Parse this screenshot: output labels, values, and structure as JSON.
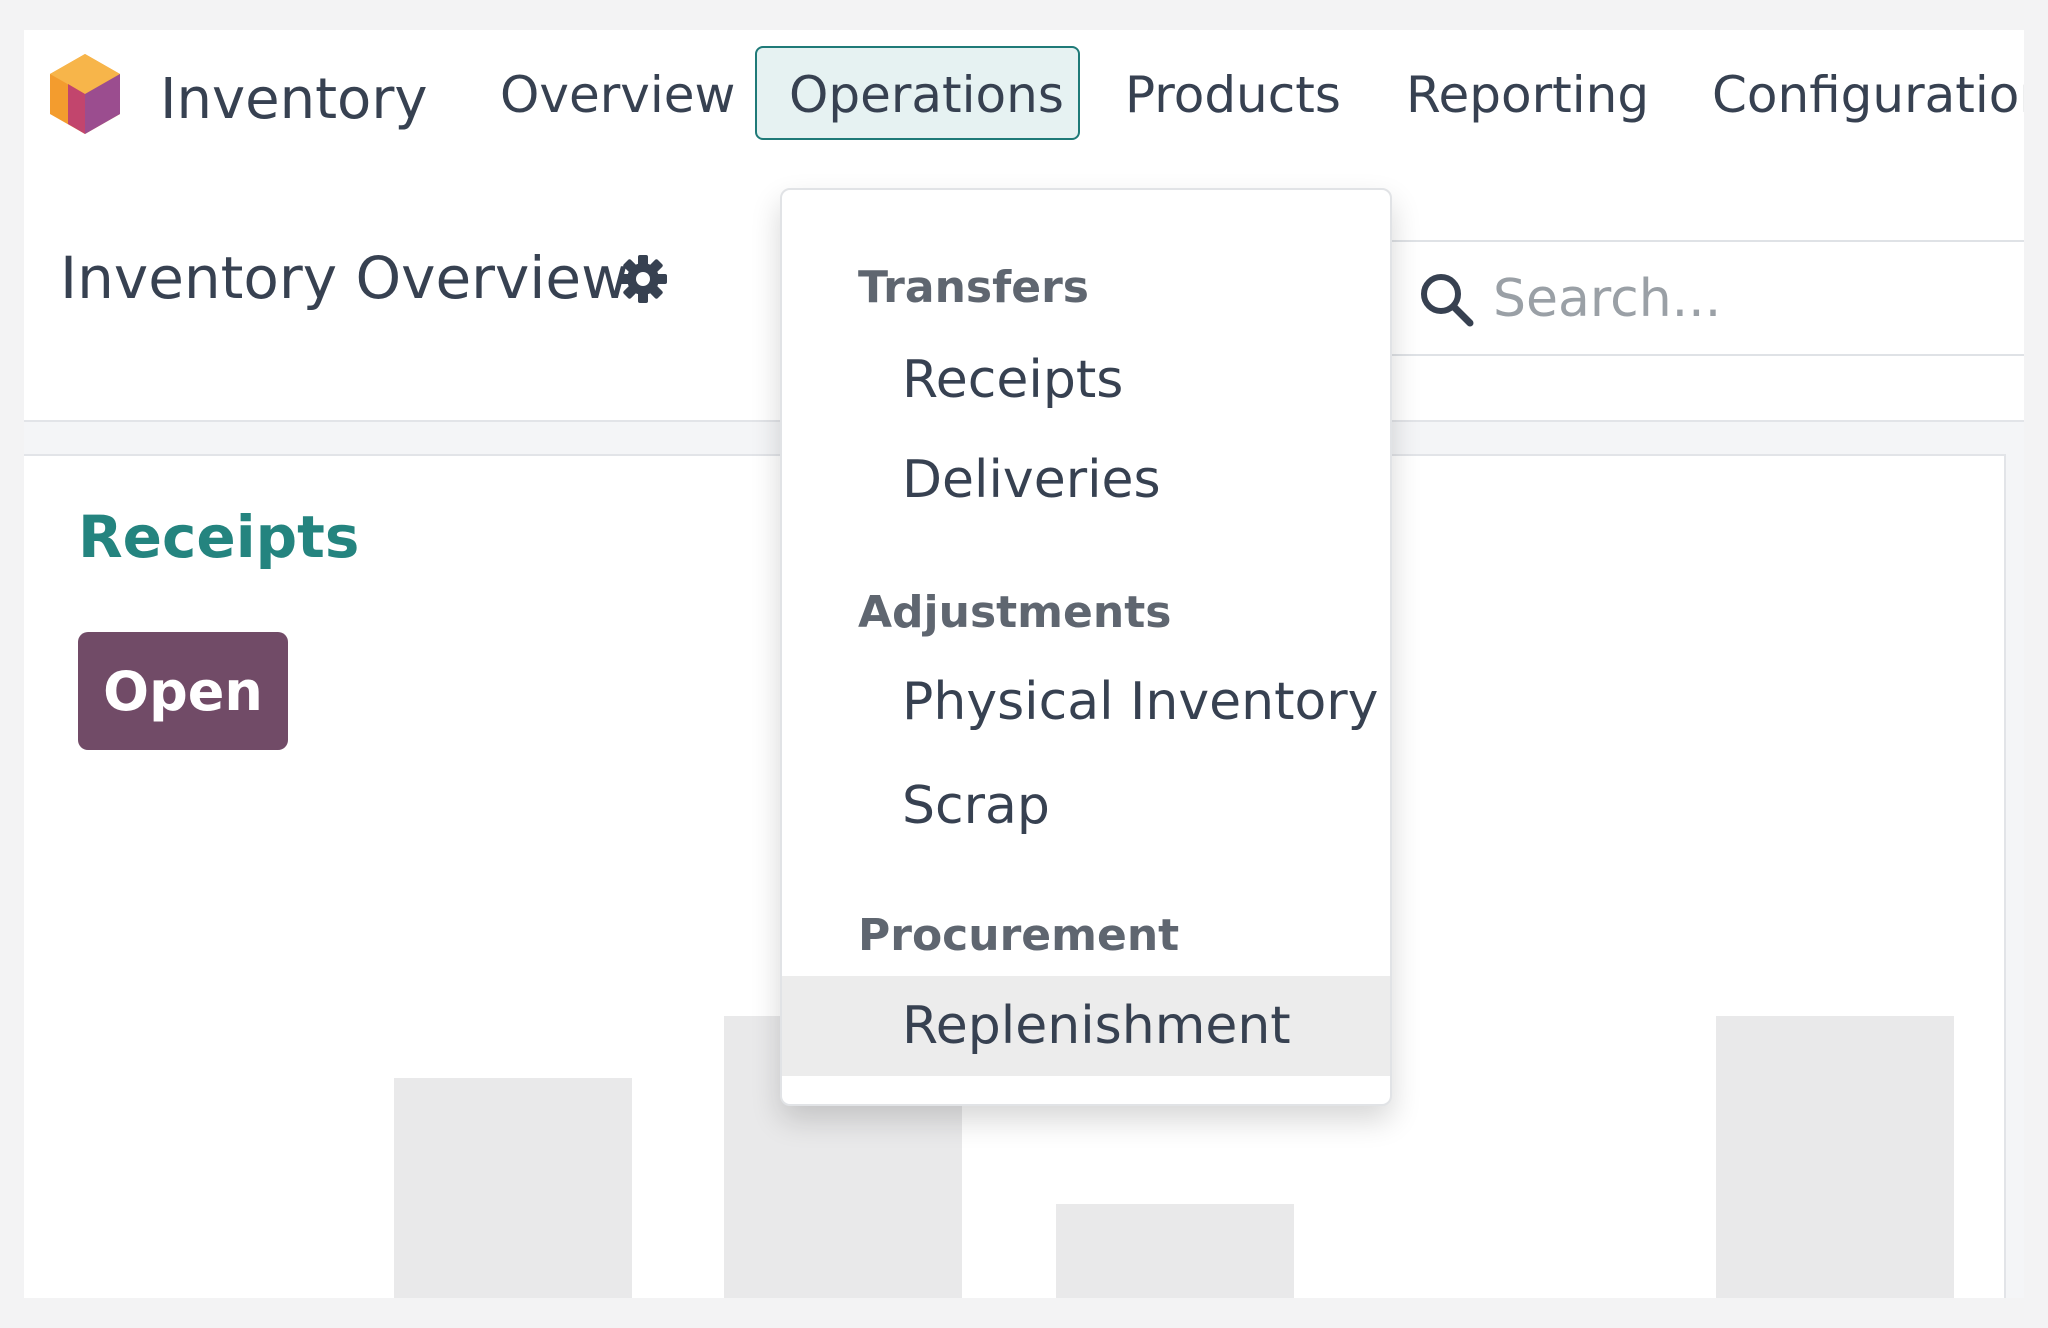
{
  "app": {
    "name": "Inventory",
    "logo_icon": "odoo-inventory-cube-icon"
  },
  "navbar": {
    "items": [
      {
        "label": "Overview"
      },
      {
        "label": "Operations",
        "active": true
      },
      {
        "label": "Products"
      },
      {
        "label": "Reporting"
      },
      {
        "label": "Configuration"
      }
    ]
  },
  "control_panel": {
    "title": "Inventory Overview",
    "settings_icon": "gear-icon",
    "search": {
      "placeholder": "Search...",
      "value": ""
    }
  },
  "card": {
    "title": "Receipts",
    "button_label": "Open"
  },
  "dropdown": {
    "sections": [
      {
        "header": "Transfers",
        "items": [
          "Receipts",
          "Deliveries"
        ]
      },
      {
        "header": "Adjustments",
        "items": [
          "Physical Inventory",
          "Scrap"
        ]
      },
      {
        "header": "Procurement",
        "items": [
          "Replenishment"
        ]
      }
    ],
    "hovered_item": "Replenishment"
  },
  "colors": {
    "primary": "#714b67",
    "accent_teal": "#24847f",
    "active_tab_bg": "#e6f2f2",
    "logo_orange": "#f39c2e",
    "logo_purple": "#9b4d8f"
  }
}
